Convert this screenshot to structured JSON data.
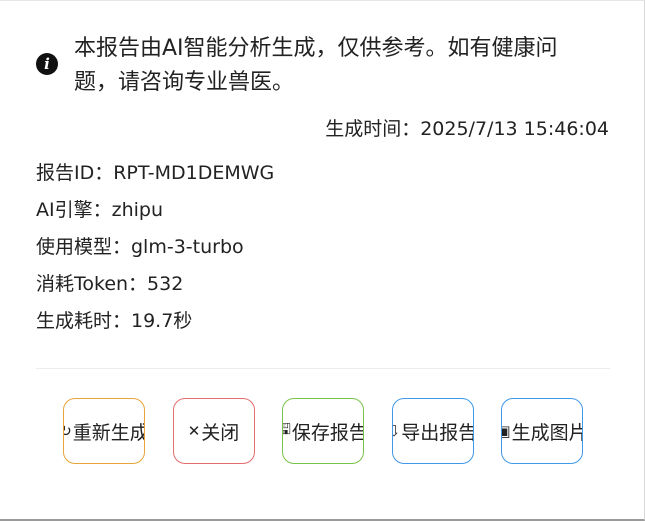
{
  "notice": {
    "icon": "info-icon",
    "text": "本报告由AI智能分析生成，仅供参考。如有健康问题，请咨询专业兽医。"
  },
  "generated_at": "生成时间：2025/7/13 15:46:04",
  "meta": [
    "报告ID：RPT-MD1DEMWG",
    "AI引擎：zhipu",
    "使用模型：glm-3-turbo",
    "消耗Token：532",
    "生成耗时：19.7秒"
  ],
  "buttons": {
    "regenerate": {
      "icon": "↻",
      "label": "重新生成",
      "color": "#e8a43b"
    },
    "close": {
      "icon": "✕",
      "label": "关闭",
      "color": "#e46d6d"
    },
    "save": {
      "icon": "🖫",
      "label": "保存报告",
      "color": "#79c24a"
    },
    "export": {
      "icon": "⇩",
      "label": "导出报告",
      "color": "#3f98e8"
    },
    "image": {
      "icon": "▣",
      "label": "生成图片",
      "color": "#3f98e8"
    }
  }
}
